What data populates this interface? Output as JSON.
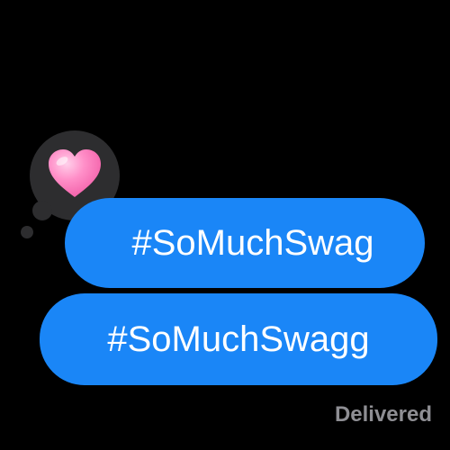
{
  "messages": [
    {
      "text": "#SoMuchSwag"
    },
    {
      "text": "#SoMuchSwagg"
    }
  ],
  "reaction": {
    "icon": "heart-icon",
    "color": "#ff8fc8"
  },
  "status": {
    "label": "Delivered"
  },
  "colors": {
    "background": "#000000",
    "bubble": "#1a86f7",
    "bubble_text": "#ffffff",
    "tapback_bubble": "#2d2d2f",
    "status_text": "#8e8e93"
  }
}
